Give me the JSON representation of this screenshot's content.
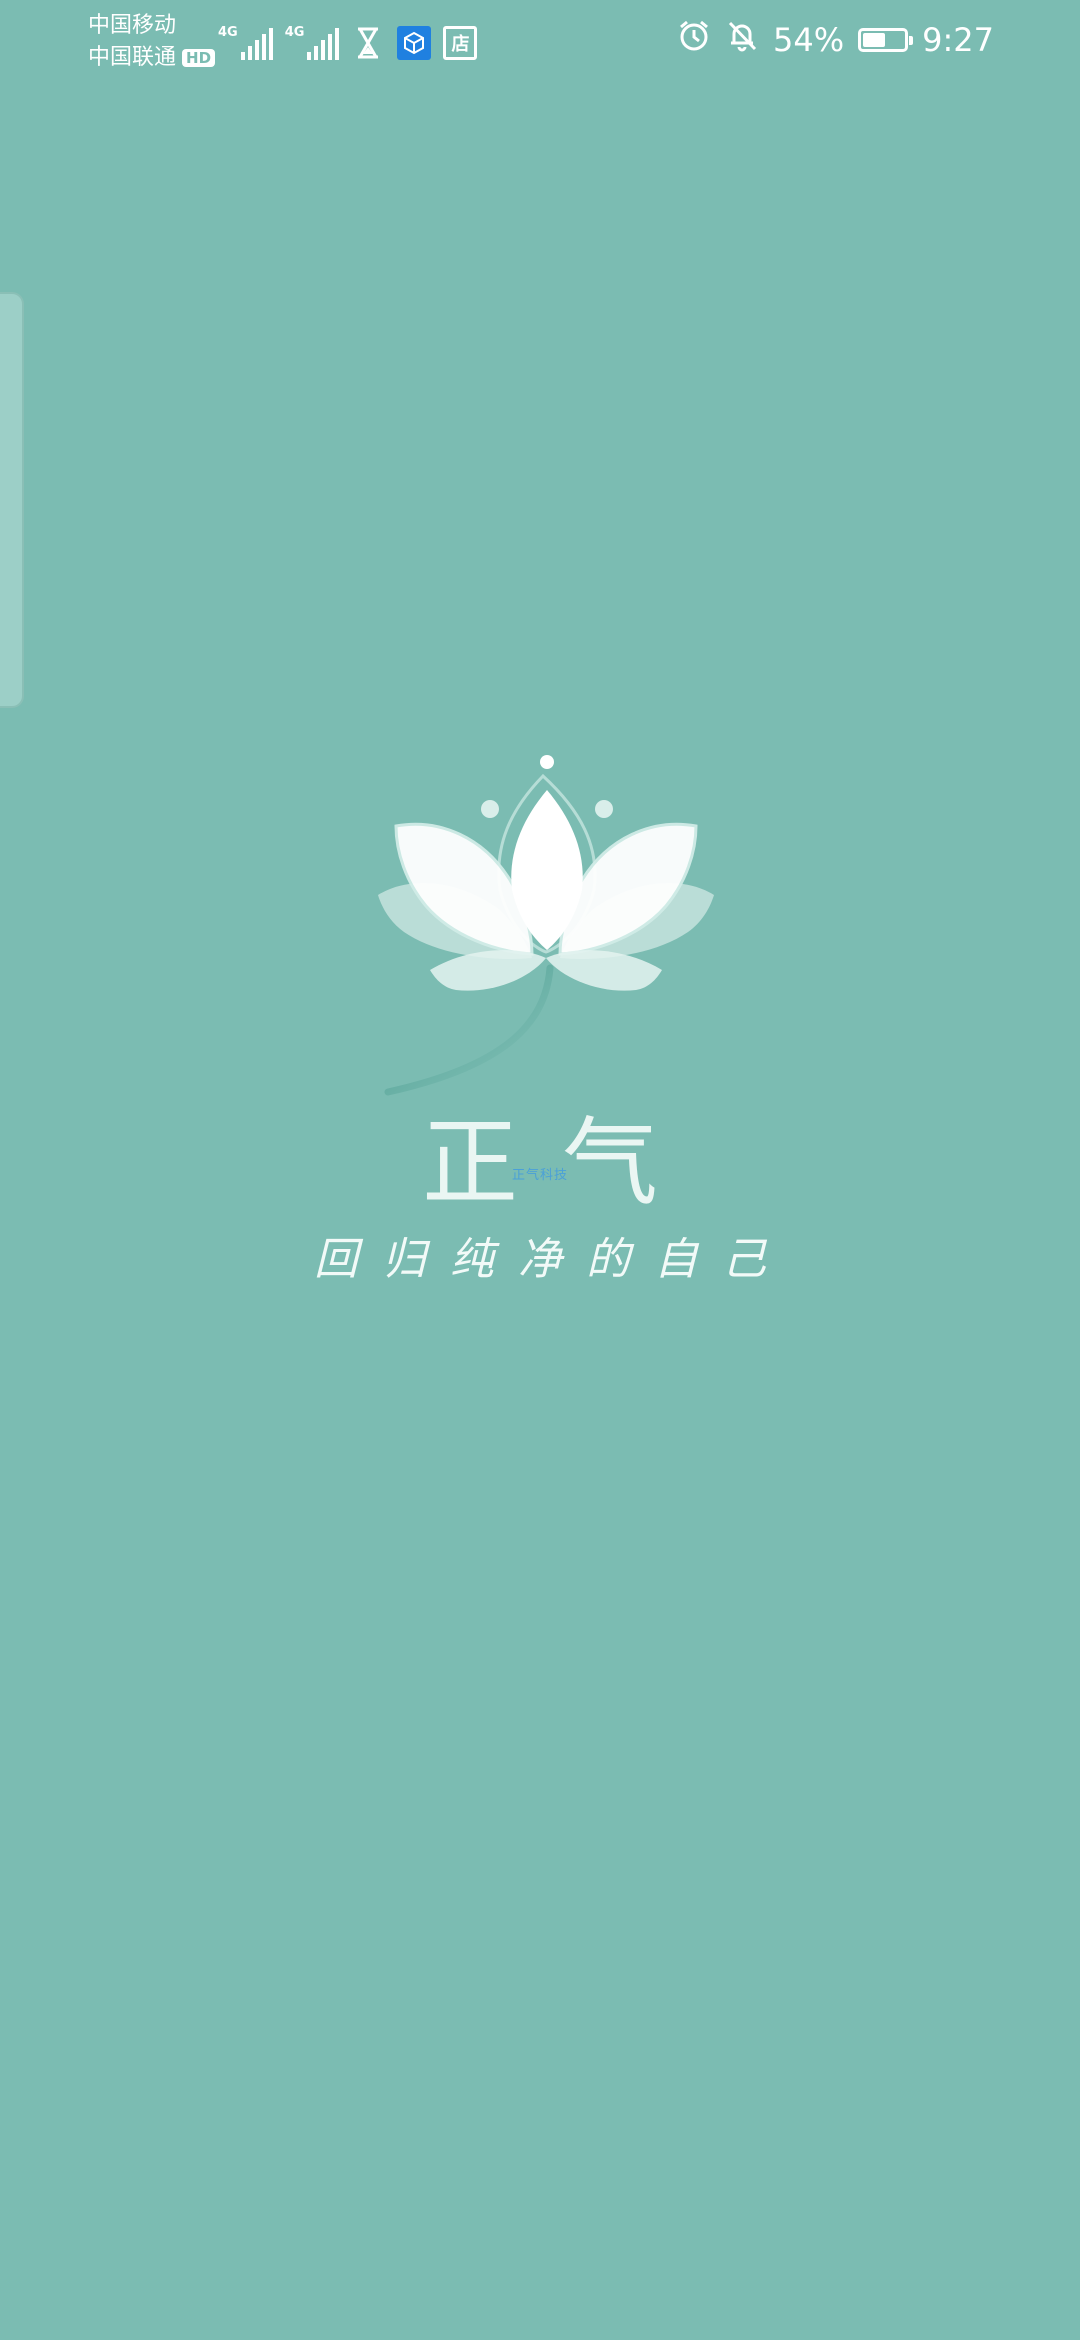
{
  "status_bar": {
    "carrier_1": "中国移动",
    "carrier_2": "中国联通",
    "carrier_2_badge": "HD",
    "network_1": "4G",
    "network_2": "4G",
    "store_app_glyph": "店",
    "battery_percent": "54%",
    "battery_level": 0.54,
    "time": "9:27",
    "icons": [
      "hourglass-icon",
      "box-icon",
      "store-icon",
      "alarm-clock-icon",
      "bell-off-icon",
      "battery-icon"
    ]
  },
  "splash": {
    "title": "正气",
    "watermark": "正气科技",
    "slogan": "回归纯净的自己",
    "logo": "lotus-logo"
  },
  "colors": {
    "background": "#7bbcb2",
    "logo_petal": "#ffffff",
    "logo_stem": "#3e9486",
    "accent_blue": "#1f80e0"
  }
}
